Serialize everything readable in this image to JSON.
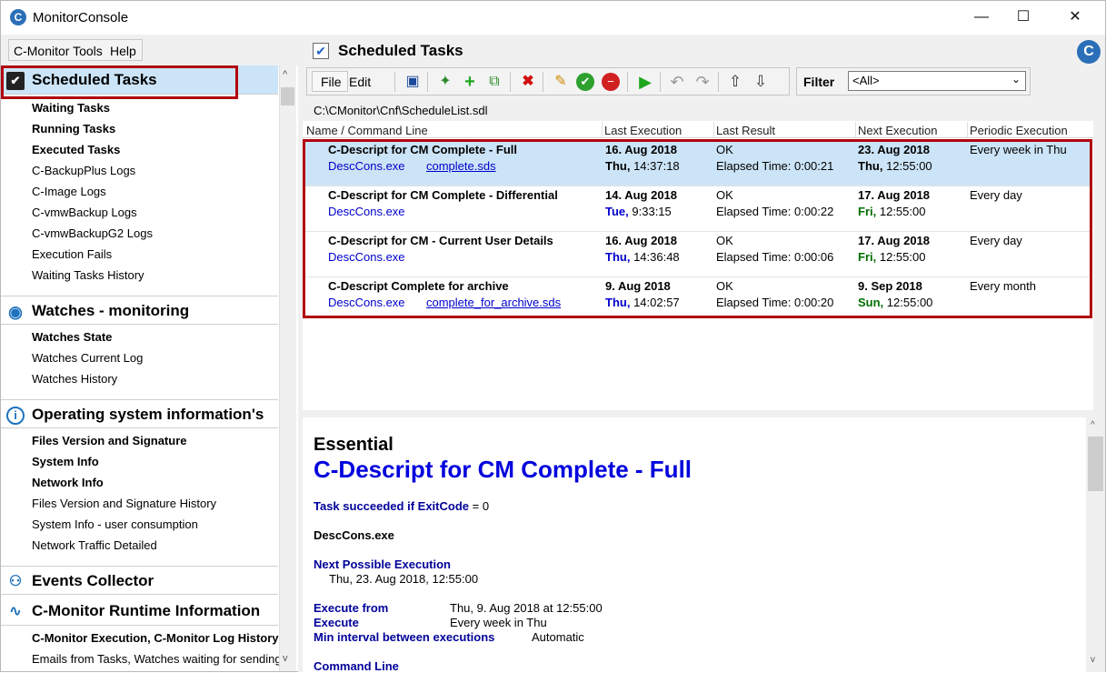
{
  "window": {
    "title": "MonitorConsole",
    "minimize_glyph": "—",
    "maximize_glyph": "☐",
    "close_glyph": "✕",
    "app_icon": "c-monitor-logo",
    "app_icon_letter": "C"
  },
  "menubar": {
    "items": [
      "C-Monitor Tools",
      "Help"
    ]
  },
  "sidebar": {
    "sections": [
      {
        "title": "Scheduled Tasks",
        "icon": "clipboard-check-icon",
        "items": [
          "Waiting Tasks",
          "Running Tasks",
          "Executed Tasks",
          "C-BackupPlus Logs",
          "C-Image Logs",
          "C-vmwBackup Logs",
          "C-vmwBackupG2 Logs",
          "Execution Fails",
          "Waiting Tasks History"
        ]
      },
      {
        "title": "Watches - monitoring",
        "icon": "eye-icon",
        "items": [
          "Watches State",
          "Watches Current Log",
          "Watches History"
        ]
      },
      {
        "title": "Operating system information's",
        "icon": "info-icon",
        "items": [
          "Files Version and Signature",
          "System Info",
          "Network Info",
          "Files Version and Signature History",
          "System Info - user consumption",
          "Network Traffic Detailed"
        ]
      },
      {
        "title": "Events Collector",
        "icon": "events-icon",
        "items": []
      },
      {
        "title": "C-Monitor Runtime Information",
        "icon": "pulse-icon",
        "items": [
          "C-Monitor Execution, C-Monitor Log History",
          "Emails from Tasks, Watches waiting for sending"
        ]
      }
    ],
    "scroll_up": "^",
    "scroll_down": "v"
  },
  "panel": {
    "title": "Scheduled Tasks",
    "logo_letter": "C",
    "header_check": "✔"
  },
  "toolbar": {
    "file_label": "File",
    "edit_label": "Edit",
    "filter_label": "Filter",
    "filter_value": "<All>"
  },
  "path": "C:\\CMonitor\\Cnf\\ScheduleList.sdl",
  "table": {
    "columns": [
      "Name / Command Line",
      "Last Execution",
      "Last Result",
      "Next Execution",
      "Periodic Execution"
    ],
    "rows": [
      {
        "name": "C-Descript for CM Complete - Full",
        "exe": "DescCons.exe",
        "param": "complete.sds",
        "last_date": "16. Aug 2018",
        "last_day": "Thu,",
        "last_time": "14:37:18",
        "result": "OK",
        "elapsed": "Elapsed Time: 0:00:21",
        "next_date": "23. Aug 2018",
        "next_day": "Thu,",
        "next_time": "12:55:00",
        "periodic": "Every week in Thu"
      },
      {
        "name": "C-Descript for CM Complete - Differential",
        "exe": "DescCons.exe",
        "param": "",
        "last_date": "14. Aug 2018",
        "last_day": "Tue,",
        "last_time": "9:33:15",
        "result": "OK",
        "elapsed": "Elapsed Time: 0:00:22",
        "next_date": "17. Aug 2018",
        "next_day": "Fri,",
        "next_time": "12:55:00",
        "periodic": "Every day"
      },
      {
        "name": "C-Descript for CM - Current User Details",
        "exe": "DescCons.exe",
        "param": "",
        "last_date": "16. Aug 2018",
        "last_day": "Thu,",
        "last_time": "14:36:48",
        "result": "OK",
        "elapsed": "Elapsed Time: 0:00:06",
        "next_date": "17. Aug 2018",
        "next_day": "Fri,",
        "next_time": "12:55:00",
        "periodic": "Every day"
      },
      {
        "name": "C-Descript Complete for archive",
        "exe": "DescCons.exe",
        "param": "complete_for_archive.sds",
        "last_date": "9. Aug 2018",
        "last_day": "Thu,",
        "last_time": "14:02:57",
        "result": "OK",
        "elapsed": "Elapsed Time: 0:00:20",
        "next_date": "9. Sep 2018",
        "next_day": "Sun,",
        "next_time": "12:55:00",
        "periodic": "Every month"
      }
    ]
  },
  "detail": {
    "heading": "Essential",
    "task_title": "C-Descript for CM Complete - Full",
    "success_label": "Task succeeded if ExitCode",
    "success_value": " = 0",
    "exe": "DescCons.exe",
    "next_label": "Next Possible Execution",
    "next_value": "Thu, 23. Aug 2018, 12:55:00",
    "from_label": "Execute from",
    "from_value": "Thu, 9. Aug 2018 at 12:55:00",
    "execute_label": "Execute",
    "execute_value": "Every week in Thu",
    "min_label": "Min interval between executions",
    "min_value": "Automatic",
    "cmd_label": "Command Line"
  },
  "colors": {
    "accent": "#0000cc",
    "highlight": "#b00010",
    "selection": "#cce4f7",
    "green": "#007000"
  }
}
